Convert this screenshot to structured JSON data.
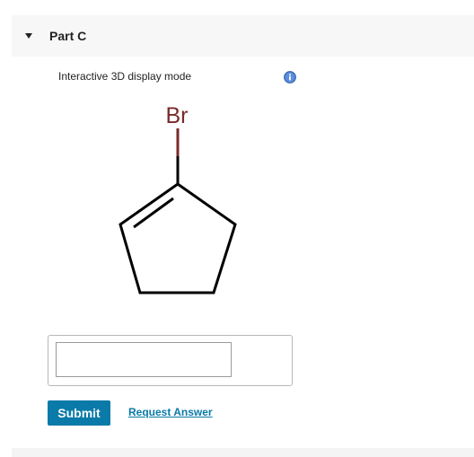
{
  "part": {
    "title": "Part C",
    "expanded": true
  },
  "viewer": {
    "display_mode_label": "Interactive 3D display mode",
    "info_icon": "info-icon",
    "molecule": {
      "substituent_label": "Br",
      "colors": {
        "bromine": "#7a2a2a",
        "bond": "#000000"
      }
    }
  },
  "answer": {
    "input_value": "",
    "submit_label": "Submit",
    "request_answer_label": "Request Answer"
  },
  "colors": {
    "accent": "#0a7aa8",
    "header_bg": "#f7f7f7",
    "info_icon": "#4a7fcf"
  }
}
